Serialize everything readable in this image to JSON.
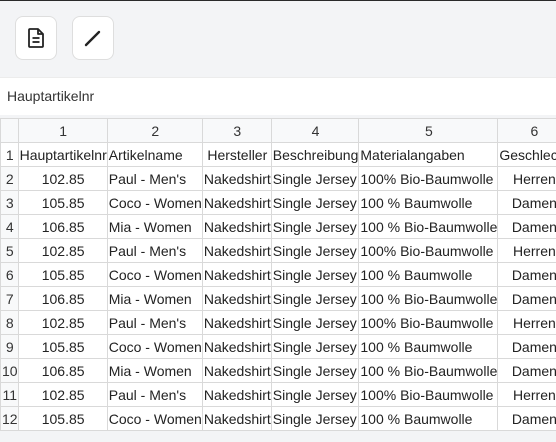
{
  "toolbar": {
    "doc_icon": "document-icon",
    "edit_icon": "pencil-icon"
  },
  "formula_bar": {
    "value": "Hauptartikelnr"
  },
  "sheet": {
    "column_headers": [
      "1",
      "2",
      "3",
      "4",
      "5",
      "6"
    ],
    "rows": [
      {
        "row": "1",
        "cells": [
          "Hauptartikelnr",
          "Artikelname",
          "Hersteller",
          "Beschreibung",
          "Materialangaben",
          "Geschlecht"
        ]
      },
      {
        "row": "2",
        "cells": [
          "102.85",
          "Paul - Men's",
          "Nakedshirt",
          "Single Jersey",
          "100% Bio-Baumwolle",
          "Herren"
        ]
      },
      {
        "row": "3",
        "cells": [
          "105.85",
          "Coco - Women",
          "Nakedshirt",
          "Single Jersey",
          "100 % Baumwolle",
          "Damen"
        ]
      },
      {
        "row": "4",
        "cells": [
          "106.85",
          "Mia - Women",
          "Nakedshirt",
          "Single Jersey",
          "100 % Bio-Baumwolle",
          "Damen"
        ]
      },
      {
        "row": "5",
        "cells": [
          "102.85",
          "Paul - Men's",
          "Nakedshirt",
          "Single Jersey",
          "100% Bio-Baumwolle",
          "Herren"
        ]
      },
      {
        "row": "6",
        "cells": [
          "105.85",
          "Coco - Women",
          "Nakedshirt",
          "Single Jersey",
          "100 % Baumwolle",
          "Damen"
        ]
      },
      {
        "row": "7",
        "cells": [
          "106.85",
          "Mia - Women",
          "Nakedshirt",
          "Single Jersey",
          "100 % Bio-Baumwolle",
          "Damen"
        ]
      },
      {
        "row": "8",
        "cells": [
          "102.85",
          "Paul - Men's",
          "Nakedshirt",
          "Single Jersey",
          "100% Bio-Baumwolle",
          "Herren"
        ]
      },
      {
        "row": "9",
        "cells": [
          "105.85",
          "Coco - Women",
          "Nakedshirt",
          "Single Jersey",
          "100 % Baumwolle",
          "Damen"
        ]
      },
      {
        "row": "10",
        "cells": [
          "106.85",
          "Mia - Women",
          "Nakedshirt",
          "Single Jersey",
          "100 % Bio-Baumwolle",
          "Damen"
        ]
      },
      {
        "row": "11",
        "cells": [
          "102.85",
          "Paul - Men's",
          "Nakedshirt",
          "Single Jersey",
          "100% Bio-Baumwolle",
          "Herren"
        ]
      },
      {
        "row": "12",
        "cells": [
          "105.85",
          "Coco - Women",
          "Nakedshirt",
          "Single Jersey",
          "100 % Baumwolle",
          "Damen"
        ]
      }
    ]
  }
}
